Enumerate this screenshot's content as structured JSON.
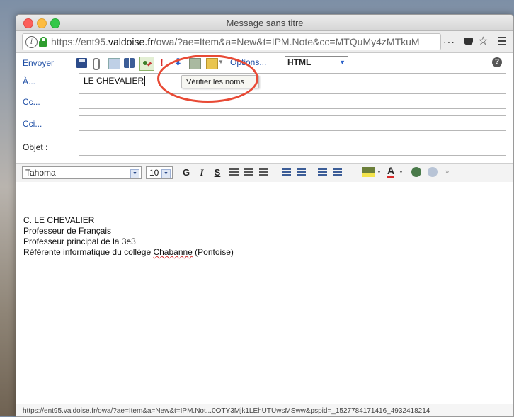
{
  "window": {
    "title": "Message sans titre"
  },
  "browser": {
    "url_prefix": "https://ent95.",
    "url_host": "valdoise.fr",
    "url_rest": "/owa/?ae=Item&a=New&t=IPM.Note&cc=MTQuMy4zMTkuM",
    "more_label": "···"
  },
  "toolbar": {
    "send_label": "Envoyer",
    "options_label": "Options...",
    "format_value": "HTML",
    "tooltip": "Vérifier les noms"
  },
  "fields": {
    "to_label": "À...",
    "to_value": "LE CHEVALIER",
    "cc_label": "Cc...",
    "cc_value": "",
    "bcc_label": "Cci...",
    "bcc_value": "",
    "subject_label": "Objet :",
    "subject_value": ""
  },
  "format_toolbar": {
    "font": "Tahoma",
    "size": "10",
    "bold": "G",
    "italic": "I",
    "underline": "S",
    "font_color": "A"
  },
  "signature": {
    "line1": "C. LE CHEVALIER",
    "line2": "Professeur de Français",
    "line3": "Professeur principal de la 3e3",
    "line4_before": "Référente informatique du collège ",
    "line4_word": "Chabanne",
    "line4_after": " (Pontoise)"
  },
  "status": {
    "text": "https://ent95.valdoise.fr/owa/?ae=Item&a=New&t=IPM.Not...0OTY3Mjk1LEhUTUwsMSww&pspid=_1527784171416_4932418214"
  },
  "colors": {
    "link": "#1f4fa6",
    "highlight_ring": "#e84a35"
  }
}
